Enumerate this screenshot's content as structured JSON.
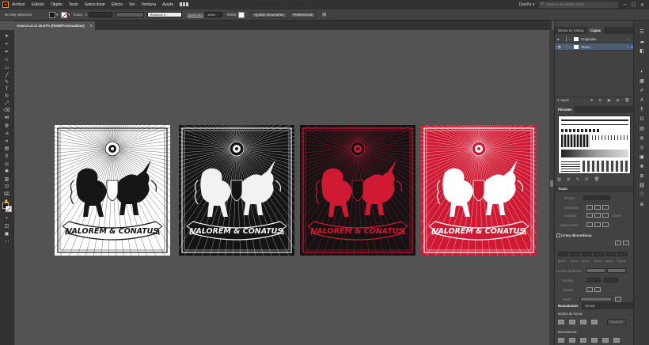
{
  "menubar": {
    "app_logo": "Ai",
    "items": [
      "Archivo",
      "Edición",
      "Objeto",
      "Texto",
      "Seleccionar",
      "Efecto",
      "Ver",
      "Ventana",
      "Ayuda"
    ],
    "workspace": "Diseño",
    "search_placeholder": "Buscar en Adobe Stock"
  },
  "controlbar": {
    "selection_status": "No hay selección",
    "stroke_label": "Trazo:",
    "brush_label": "Redondo 5 ...",
    "opacity_label": "Opacidad:",
    "opacity_value": "100%",
    "style_label": "Estilo:",
    "doc_setup_button": "Ajustar documento",
    "preferences_button": "Preferencias"
  },
  "document": {
    "tab_title": "Avance.ai al 16.67% (RGB/Previsualizar)"
  },
  "artboards": [
    {
      "variant": "white-bg-black-art",
      "bg": "#ffffff",
      "ink": "#161616",
      "text": "VALOREM & CONATUS"
    },
    {
      "variant": "black-bg-white-art",
      "bg": "#141414",
      "ink": "#f2f2f2",
      "text": "VALOREM & CONATUS"
    },
    {
      "variant": "black-bg-red-art",
      "bg": "#151213",
      "ink": "#d01a34",
      "text": "VALOREM & CONATUS"
    },
    {
      "variant": "red-bg-white-art",
      "bg": "#d01a34",
      "ink": "#ffffff",
      "text": "VALOREM & CONATUS"
    }
  ],
  "panel": {
    "tabs_top": [
      "Mesas de trabajo",
      "Capas"
    ],
    "layers": [
      {
        "name": "Originales",
        "color": "#3c84ff",
        "selected": false
      },
      {
        "name": "Tazas",
        "color": "#ff3c3c",
        "selected": true
      }
    ],
    "layers_count": "2 capas",
    "brushes_title": "Pinceles",
    "stroke_title": "Trazo",
    "stroke_fields": {
      "weight": "Grosor:",
      "ends": "Extremos:",
      "corner": "Esquina:",
      "limit": "Límite:",
      "align": "Alinear trazo:"
    },
    "dashed_title": "Línea discontinua",
    "dash_labels": [
      "guión",
      "hueco",
      "guión",
      "hueco",
      "guión",
      "hueco"
    ],
    "arrow_labels": {
      "arrows": "Puntas de flecha:",
      "scale": "Escala:",
      "align": "Alinear:",
      "profile": "Perfil:"
    },
    "pathfinder_tabs": [
      "Buscatrazos",
      "Alinear"
    ],
    "shape_modes": "Modos de forma:",
    "expand_button": "Expandir",
    "pathfinders_label": "Buscatrazos:"
  },
  "colors": {
    "accent_red": "#d01a34",
    "ui_dark": "#323232",
    "ui_mid": "#424242",
    "canvas": "#535353"
  }
}
